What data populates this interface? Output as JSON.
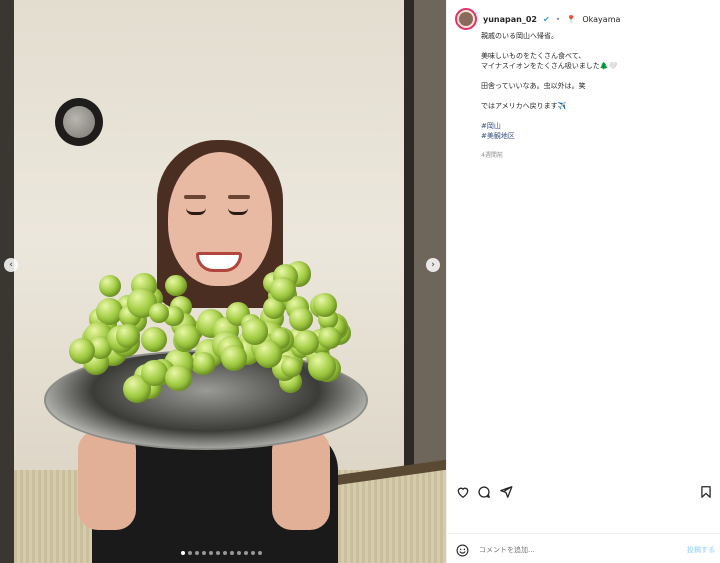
{
  "post": {
    "username": "yunapan_02",
    "location": "Okayama",
    "caption_lines": [
      "親戚のいる岡山へ帰省。",
      "美味しいものをたくさん食べて、",
      "マイナスイオンをたくさん吸いました🌲🤍",
      "田舎っていいなあ。虫以外は。笑",
      "ではアメリカへ戻ります✈️"
    ],
    "hashtags": [
      "#岡山",
      "#美観地区"
    ],
    "timestamp": "4週間前"
  },
  "carousel": {
    "slide_count": 12,
    "current_index": 0
  },
  "comment_box": {
    "placeholder": "コメントを追加...",
    "post_label": "投稿する"
  },
  "icons": {
    "verified": "verified-badge-icon",
    "location": "location-pin-icon",
    "like": "heart-icon",
    "comment": "comment-icon",
    "share": "send-icon",
    "save": "bookmark-icon",
    "emoji": "smiley-icon",
    "prev": "chevron-left-icon",
    "next": "chevron-right-icon"
  },
  "colors": {
    "link": "#385185",
    "verified": "#3897f0",
    "post_button": "#b2dffc",
    "pin": "#e0245e"
  }
}
